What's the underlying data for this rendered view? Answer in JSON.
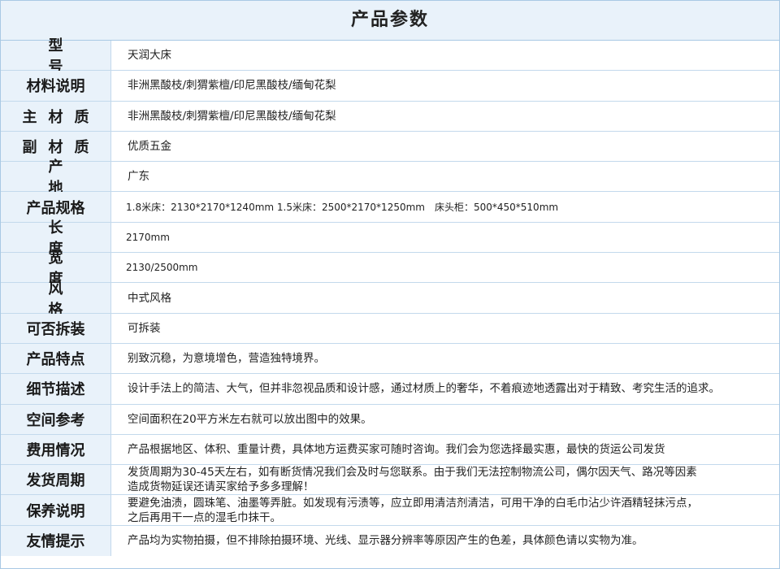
{
  "title": "产品参数",
  "rows": [
    {
      "label": "型号",
      "value": "天润大床"
    },
    {
      "label": "材料说明",
      "value": "非洲黑酸枝/刺猬紫檀/印尼黑酸枝/缅甸花梨"
    },
    {
      "label": "主材质",
      "value": "非洲黑酸枝/刺猬紫檀/印尼黑酸枝/缅甸花梨"
    },
    {
      "label": "副材质",
      "value": "优质五金"
    },
    {
      "label": "产地",
      "value": "广东"
    },
    {
      "label": "产品规格",
      "value": "1.8米床：2130*2170*1240mm 1.5米床：2500*2170*1250mm　床头柜：500*450*510mm"
    },
    {
      "label": "长度",
      "value": "2170mm"
    },
    {
      "label": "宽度",
      "value": "2130/2500mm"
    },
    {
      "label": "风格",
      "value": "中式风格"
    },
    {
      "label": "可否拆装",
      "value": "可拆装"
    },
    {
      "label": "产品特点",
      "value": "别致沉稳，为意境增色，营造独特境界。"
    },
    {
      "label": "细节描述",
      "value": "设计手法上的简洁、大气，但并非忽视品质和设计感，通过材质上的奢华，不着痕迹地透露出对于精致、考究生活的追求。"
    },
    {
      "label": "空间参考",
      "value": "空间面积在20平方米左右就可以放出图中的效果。"
    },
    {
      "label": "费用情况",
      "value": "产品根据地区、体积、重量计费，具体地方运费买家可随时咨询。我们会为您选择最实惠，最快的货运公司发货"
    },
    {
      "label": "发货周期",
      "value": "发货周期为30-45天左右，如有断货情况我们会及时与您联系。由于我们无法控制物流公司，偶尔因天气、路况等因素\n造成货物延误还请买家给予多多理解！"
    },
    {
      "label": "保养说明",
      "value": "要避免油渍，圆珠笔、油墨等弄脏。如发现有污渍等，应立即用清洁剂清洁，可用干净的白毛巾沾少许酒精轻抹污点，\n之后再用干一点的湿毛巾抹干。"
    },
    {
      "label": "友情提示",
      "value": "产品均为实物拍摄，但不排除拍摄环境、光线、显示器分辨率等原因产生的色差，具体颜色请以实物为准。"
    }
  ]
}
